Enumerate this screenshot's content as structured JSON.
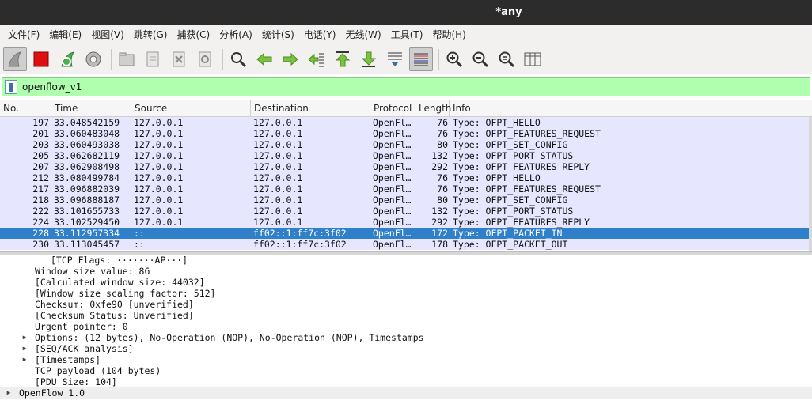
{
  "window": {
    "title": "*any"
  },
  "menu": [
    {
      "label": "文件(F)"
    },
    {
      "label": "编辑(E)"
    },
    {
      "label": "视图(V)"
    },
    {
      "label": "跳转(G)"
    },
    {
      "label": "捕获(C)"
    },
    {
      "label": "分析(A)"
    },
    {
      "label": "统计(S)"
    },
    {
      "label": "电话(Y)"
    },
    {
      "label": "无线(W)"
    },
    {
      "label": "工具(T)"
    },
    {
      "label": "帮助(H)"
    }
  ],
  "toolbar": {
    "icons": [
      "shark-fin-start-icon",
      "stop-capture-icon",
      "restart-capture-icon",
      "capture-options-gear-icon",
      "open-file-icon",
      "save-file-icon",
      "close-file-icon",
      "reload-file-icon",
      "find-packet-icon",
      "go-back-icon",
      "go-forward-icon",
      "go-to-packet-icon",
      "go-first-packet-icon",
      "go-last-packet-icon",
      "auto-scroll-icon",
      "colorize-icon",
      "zoom-in-icon",
      "zoom-out-icon",
      "normal-size-icon",
      "resize-columns-icon"
    ]
  },
  "filter": {
    "value": "openflow_v1"
  },
  "packet_list": {
    "columns": [
      "No.",
      "Time",
      "Source",
      "Destination",
      "Protocol",
      "Length",
      "Info"
    ],
    "rows": [
      {
        "no": "197",
        "time": "33.048542159",
        "src": "127.0.0.1",
        "dst": "127.0.0.1",
        "proto": "OpenFl…",
        "len": "76",
        "info": "Type: OFPT_HELLO"
      },
      {
        "no": "201",
        "time": "33.060483048",
        "src": "127.0.0.1",
        "dst": "127.0.0.1",
        "proto": "OpenFl…",
        "len": "76",
        "info": "Type: OFPT_FEATURES_REQUEST"
      },
      {
        "no": "203",
        "time": "33.060493038",
        "src": "127.0.0.1",
        "dst": "127.0.0.1",
        "proto": "OpenFl…",
        "len": "80",
        "info": "Type: OFPT_SET_CONFIG"
      },
      {
        "no": "205",
        "time": "33.062682119",
        "src": "127.0.0.1",
        "dst": "127.0.0.1",
        "proto": "OpenFl…",
        "len": "132",
        "info": "Type: OFPT_PORT_STATUS"
      },
      {
        "no": "207",
        "time": "33.062908498",
        "src": "127.0.0.1",
        "dst": "127.0.0.1",
        "proto": "OpenFl…",
        "len": "292",
        "info": "Type: OFPT_FEATURES_REPLY"
      },
      {
        "no": "212",
        "time": "33.080499784",
        "src": "127.0.0.1",
        "dst": "127.0.0.1",
        "proto": "OpenFl…",
        "len": "76",
        "info": "Type: OFPT_HELLO"
      },
      {
        "no": "217",
        "time": "33.096882039",
        "src": "127.0.0.1",
        "dst": "127.0.0.1",
        "proto": "OpenFl…",
        "len": "76",
        "info": "Type: OFPT_FEATURES_REQUEST"
      },
      {
        "no": "218",
        "time": "33.096888187",
        "src": "127.0.0.1",
        "dst": "127.0.0.1",
        "proto": "OpenFl…",
        "len": "80",
        "info": "Type: OFPT_SET_CONFIG"
      },
      {
        "no": "222",
        "time": "33.101655733",
        "src": "127.0.0.1",
        "dst": "127.0.0.1",
        "proto": "OpenFl…",
        "len": "132",
        "info": "Type: OFPT_PORT_STATUS"
      },
      {
        "no": "224",
        "time": "33.102529450",
        "src": "127.0.0.1",
        "dst": "127.0.0.1",
        "proto": "OpenFl…",
        "len": "292",
        "info": "Type: OFPT_FEATURES_REPLY"
      },
      {
        "no": "228",
        "time": "33.112957334",
        "src": "::",
        "dst": "ff02::1:ff7c:3f02",
        "proto": "OpenFl…",
        "len": "172",
        "info": "Type: OFPT_PACKET_IN",
        "selected": true
      },
      {
        "no": "230",
        "time": "33.113045457",
        "src": "::",
        "dst": "ff02::1:ff7c:3f02",
        "proto": "OpenFl…",
        "len": "178",
        "info": "Type: OFPT_PACKET_OUT"
      }
    ]
  },
  "details": {
    "rows": [
      {
        "text": "[TCP Flags: ·······AP···]",
        "indent": 3,
        "expandable": false
      },
      {
        "text": "Window size value: 86",
        "indent": 2,
        "expandable": false
      },
      {
        "text": "[Calculated window size: 44032]",
        "indent": 2,
        "expandable": false
      },
      {
        "text": "[Window size scaling factor: 512]",
        "indent": 2,
        "expandable": false
      },
      {
        "text": "Checksum: 0xfe90 [unverified]",
        "indent": 2,
        "expandable": false
      },
      {
        "text": "[Checksum Status: Unverified]",
        "indent": 2,
        "expandable": false
      },
      {
        "text": "Urgent pointer: 0",
        "indent": 2,
        "expandable": false
      },
      {
        "text": "Options: (12 bytes), No-Operation (NOP), No-Operation (NOP), Timestamps",
        "indent": 2,
        "expandable": true
      },
      {
        "text": "[SEQ/ACK analysis]",
        "indent": 2,
        "expandable": true
      },
      {
        "text": "[Timestamps]",
        "indent": 2,
        "expandable": true
      },
      {
        "text": "TCP payload (104 bytes)",
        "indent": 2,
        "expandable": false
      },
      {
        "text": "[PDU Size: 104]",
        "indent": 2,
        "expandable": false
      },
      {
        "text": "OpenFlow 1.0",
        "indent": 1,
        "expandable": true,
        "shaded": true
      }
    ]
  },
  "colors": {
    "filter_bg": "#afffaf",
    "row_bg": "#e7e6ff",
    "selected_bg": "#2f80c8",
    "titlebar_bg": "#2c2c2c"
  }
}
